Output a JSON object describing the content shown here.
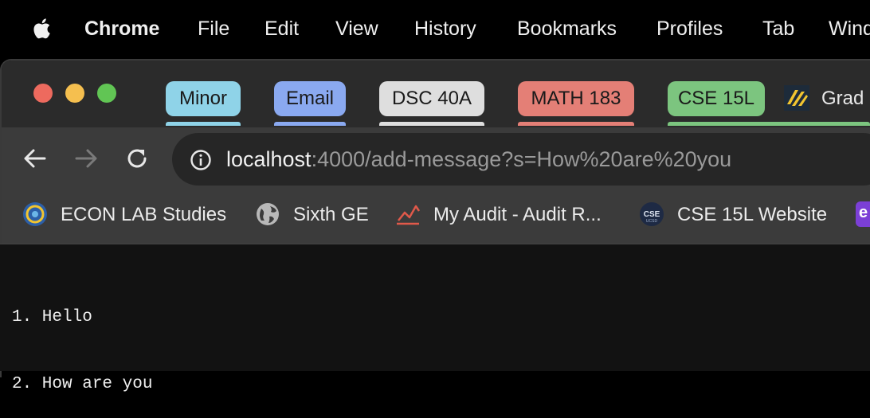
{
  "menubar": {
    "app": "Chrome",
    "items": [
      "File",
      "Edit",
      "View",
      "History",
      "Bookmarks",
      "Profiles",
      "Tab",
      "Wind"
    ]
  },
  "tab_groups": [
    {
      "label": "Minor",
      "color": "#8fd3e8"
    },
    {
      "label": "Email",
      "color": "#8aa9f0"
    },
    {
      "label": "DSC 40A",
      "color": "#dedede"
    },
    {
      "label": "MATH 183",
      "color": "#e47f76"
    },
    {
      "label": "CSE 15L",
      "color": "#7cc57f"
    }
  ],
  "partial_tab": {
    "label": "Grad",
    "icon": "gradescope-icon"
  },
  "omnibox": {
    "host": "localhost",
    "rest": ":4000/add-message?s=How%20are%20you"
  },
  "bookmarks": [
    {
      "label": "ECON LAB Studies",
      "icon": "econ-lab-icon"
    },
    {
      "label": "Sixth GE",
      "icon": "globe-icon"
    },
    {
      "label": "My Audit - Audit R...",
      "icon": "audit-chart-icon"
    },
    {
      "label": "CSE 15L Website",
      "icon": "cse-icon"
    }
  ],
  "page": {
    "messages": [
      "1. Hello",
      "2. How are you"
    ]
  },
  "colors": {
    "close": "#ed6a5e",
    "minimize": "#f5bf4f",
    "zoom": "#61c554"
  }
}
